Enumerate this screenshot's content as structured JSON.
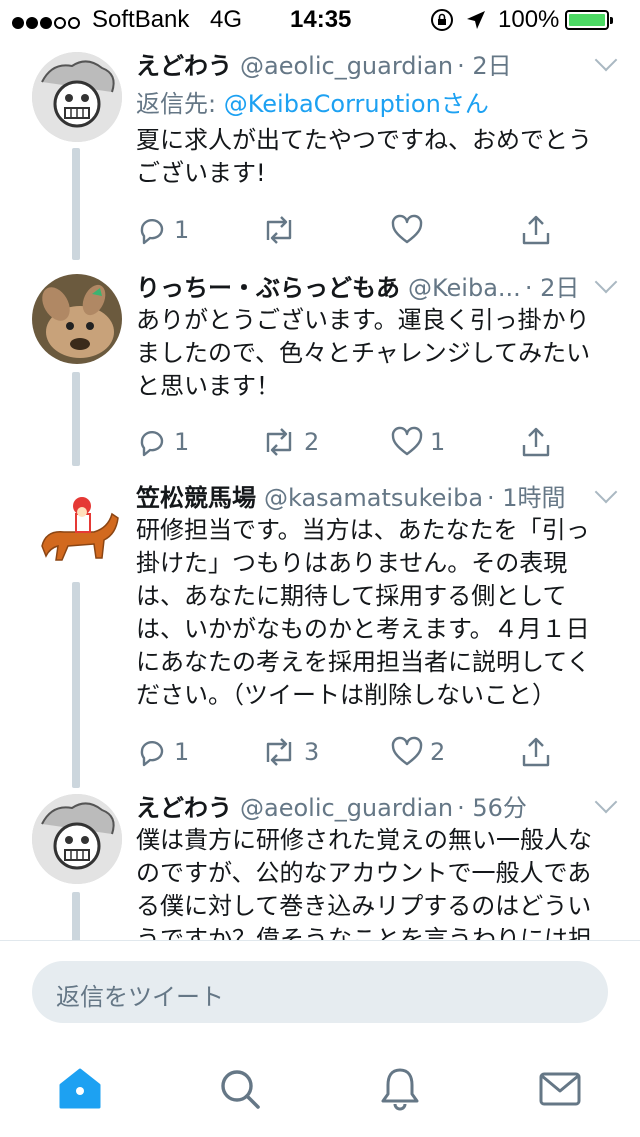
{
  "status_bar": {
    "carrier": "SoftBank",
    "network": "4G",
    "time": "14:35",
    "battery": "100%",
    "signal_dots_on": 3,
    "signal_dots_total": 5
  },
  "tweets": [
    {
      "name": "えどわう",
      "handle": "@aeolic_guardian",
      "time": "· 2日",
      "reply_prefix": "返信先:",
      "reply_mention": "@KeibaCorruption",
      "reply_suffix": "さん",
      "lines": [
        "夏に求人が出てたやつですね、おめでとう",
        "ございます!"
      ],
      "replies": "1",
      "retweets": "",
      "likes": ""
    },
    {
      "name": "りっちー・ぶらっどもあ",
      "handle": "@Keiba...",
      "time": "· 2日",
      "lines": [
        "ありがとうございます。運良く引っ掛かり",
        "ましたので、色々とチャレンジしてみたい",
        "と思います！"
      ],
      "replies": "1",
      "retweets": "2",
      "likes": "1"
    },
    {
      "name": "笠松競馬場",
      "handle": "@kasamatsukeiba",
      "time": "· 1時間",
      "lines": [
        "研修担当です。当方は、あたなたを「引っ",
        "掛けた」つもりはありません。その表現",
        "は、あなたに期待して採用する側として",
        "は、いかがなものかと考えます。４月１日",
        "にあなたの考えを採用担当者に説明してく",
        "ださい。（ツイートは削除しないこと）"
      ],
      "replies": "1",
      "retweets": "3",
      "likes": "2"
    },
    {
      "name": "えどわう",
      "handle": "@aeolic_guardian",
      "time": "· 56分",
      "lines": [
        "僕は貴方に研修された覚えの無い一般人な",
        "のですが、公的なアカウントで一般人であ",
        "る僕に対して巻き込みリプするのはどうい",
        "うですか？偉そうなことを言うわりには担"
      ]
    }
  ],
  "compose": {
    "placeholder": "返信をツイート"
  },
  "colors": {
    "accent": "#1da1f2",
    "muted": "#657786",
    "thread_line": "#ccd6dd",
    "battery": "#4cd964"
  },
  "icons": [
    "reply-icon",
    "retweet-icon",
    "like-icon",
    "share-icon",
    "caret-down-icon",
    "home-icon",
    "search-icon",
    "notifications-icon",
    "messages-icon"
  ]
}
